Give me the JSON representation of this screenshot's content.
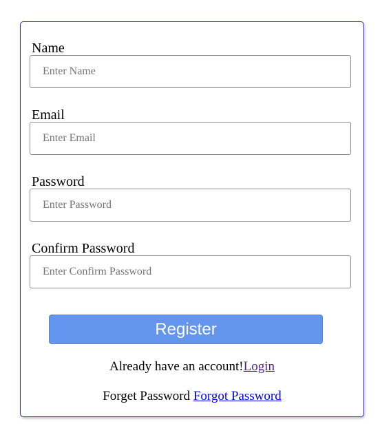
{
  "form": {
    "name": {
      "label": "Name",
      "placeholder": "Enter Name"
    },
    "email": {
      "label": "Email",
      "placeholder": "Enter Email"
    },
    "password": {
      "label": "Password",
      "placeholder": "Enter Password"
    },
    "confirm_password": {
      "label": "Confirm Password",
      "placeholder": "Enter Confirm Password"
    },
    "register_label": "Register"
  },
  "footer": {
    "account_text": "Already have an account!",
    "login_link": "Login",
    "forget_text": "Forget Password",
    "forgot_link": "Forgot Password"
  },
  "colors": {
    "card_border": "#2b2bd6",
    "button_bg": "#6495ed",
    "visited_link": "#551a8b",
    "link": "#0000ee"
  }
}
